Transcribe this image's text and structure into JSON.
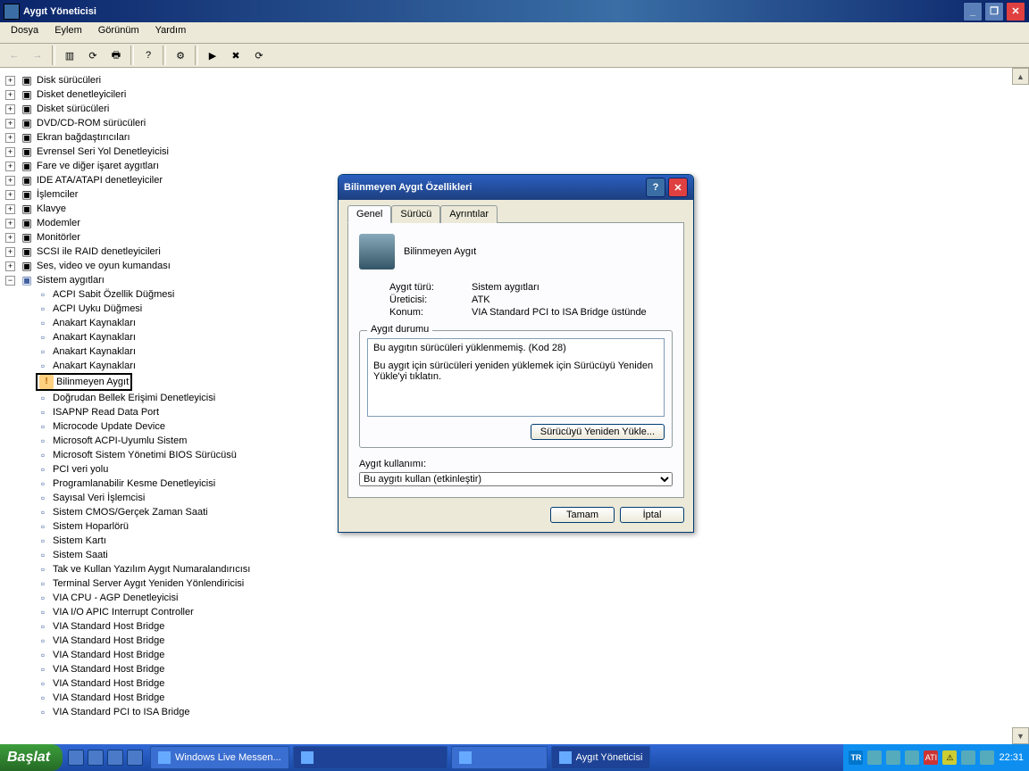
{
  "window": {
    "title": "Aygıt Yöneticisi"
  },
  "menu": {
    "file": "Dosya",
    "action": "Eylem",
    "view": "Görünüm",
    "help": "Yardım"
  },
  "tree_top": [
    "Disk sürücüleri",
    "Disket denetleyicileri",
    "Disket sürücüleri",
    "DVD/CD-ROM sürücüleri",
    "Ekran bağdaştırıcıları",
    "Evrensel Seri Yol Denetleyicisi",
    "Fare ve diğer işaret aygıtları",
    "IDE ATA/ATAPI denetleyiciler",
    "İşlemciler",
    "Klavye",
    "Modemler",
    "Monitörler",
    "SCSI ile RAID denetleyicileri",
    "Ses, video ve oyun kumandası"
  ],
  "tree_sys_label": "Sistem aygıtları",
  "tree_sys": [
    "ACPI Sabit Özellik Düğmesi",
    "ACPI Uyku Düğmesi",
    "Anakart Kaynakları",
    "Anakart Kaynakları",
    "Anakart Kaynakları",
    "Anakart Kaynakları",
    "Bilinmeyen Aygıt",
    "Doğrudan Bellek Erişimi Denetleyicisi",
    "ISAPNP Read Data Port",
    "Microcode Update Device",
    "Microsoft ACPI-Uyumlu Sistem",
    "Microsoft Sistem Yönetimi BIOS Sürücüsü",
    "PCI veri yolu",
    "Programlanabilir Kesme Denetleyicisi",
    "Sayısal Veri İşlemcisi",
    "Sistem CMOS/Gerçek Zaman Saati",
    "Sistem Hoparlörü",
    "Sistem Kartı",
    "Sistem Saati",
    "Tak ve Kullan Yazılım Aygıt Numaralandırıcısı",
    "Terminal Server Aygıt Yeniden Yönlendiricisi",
    "VIA CPU - AGP Denetleyicisi",
    "VIA I/O APIC Interrupt Controller",
    "VIA Standard Host Bridge",
    "VIA Standard Host Bridge",
    "VIA Standard Host Bridge",
    "VIA Standard Host Bridge",
    "VIA Standard Host Bridge",
    "VIA Standard Host Bridge",
    "VIA Standard PCI to ISA Bridge"
  ],
  "tree_highlight_index": 6,
  "dialog": {
    "title": "Bilinmeyen Aygıt Özellikleri",
    "tabs": {
      "general": "Genel",
      "driver": "Sürücü",
      "details": "Ayrıntılar"
    },
    "devname": "Bilinmeyen Aygıt",
    "labels": {
      "type": "Aygıt türü:",
      "mfg": "Üreticisi:",
      "loc": "Konum:"
    },
    "values": {
      "type": "Sistem aygıtları",
      "mfg": "ATK",
      "loc": "VIA Standard PCI to ISA Bridge üstünde"
    },
    "status_label": "Aygıt durumu",
    "status_line1": "Bu aygıtın sürücüleri yüklenmemiş. (Kod 28)",
    "status_line2": "Bu aygıt için sürücüleri yeniden yüklemek için Sürücüyü Yeniden Yükle'yi tıklatın.",
    "reinstall_btn": "Sürücüyü Yeniden Yükle...",
    "usage_label": "Aygıt kullanımı:",
    "usage_value": "Bu aygıtı kullan (etkinleştir)",
    "ok": "Tamam",
    "cancel": "İptal"
  },
  "taskbar": {
    "start": "Başlat",
    "items": [
      "Windows Live Messen...",
      "",
      "",
      "Aygıt Yöneticisi"
    ],
    "lang": "TR",
    "clock": "22:31"
  }
}
